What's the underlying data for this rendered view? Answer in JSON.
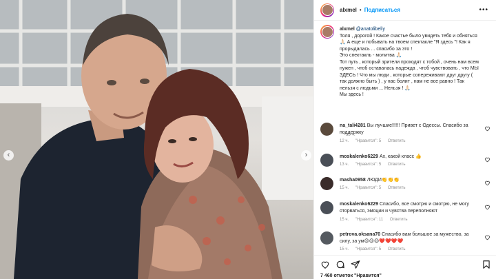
{
  "post": {
    "username": "alxmel",
    "follow_label": "Подписаться",
    "caption_mention": "@anatolibeliy",
    "caption_lines": [
      "Толя , дорогой ! Какое счастье было увидеть тебя и обняться",
      "🙏🏻 А еще и побывать на твоем спектакле \"Я здесь \"! Как я",
      "прорыдалась ... спасибо за это !",
      "Это спектакль - молитва 🙏🏻",
      "Тот путь , который зрители проходят с тобой , очень нам всем",
      "нужен , чтоб оставалась надежда , чтоб чувствовать , что МЫ",
      "ЗДЕСЬ ! Что мы люди , которые сопереживают друг другу (",
      "так должно быть ) , у нас болит , нам не все равно ! Так",
      "нельзя с людьми ... Нельзя ! 🙏🏻",
      "Мы здесь !"
    ],
    "caption_time": "15 ч.",
    "likes": "7 460 отметок \"Нравится\""
  },
  "comments": [
    {
      "username": "na_tali4281",
      "text_lines": [
        "Вы лучшие!!!!!! Привет с Одессы. Спасибо за",
        "поддержку"
      ],
      "time": "12 ч.",
      "likes": "\"Нравится\": 5",
      "reply": "Ответить",
      "avatar_color": "#5a4a3c"
    },
    {
      "username": "moskalenko6229",
      "text_lines": [
        "Ах, какой класс 👍"
      ],
      "time": "13 ч.",
      "likes": "\"Нравится\": 5",
      "reply": "Ответить",
      "avatar_color": "#4a4f57"
    },
    {
      "username": "masha0958",
      "text_lines": [
        "ЛЮДИ👏👏👏"
      ],
      "time": "15 ч.",
      "likes": "\"Нравится\": 5",
      "reply": "Ответить",
      "avatar_color": "#3a2c2a"
    },
    {
      "username": "moskalenko6229",
      "text_lines": [
        "Спасибо, все смотрю и смотрю, не могу",
        "оторваться, эмоции и чувства переполняют"
      ],
      "time": "15 ч.",
      "likes": "\"Нравится\": 11",
      "reply": "Ответить",
      "avatar_color": "#4a4f57"
    },
    {
      "username": "petrova.oksana70",
      "text_lines": [
        "Спасибо вам большое за мужество, за",
        "силу, за ум😍😍😍❤️❤️❤️❤️"
      ],
      "time": "15 ч.",
      "likes": "\"Нравится\": 5",
      "reply": "Ответить",
      "avatar_color": "#555a60"
    }
  ],
  "icons": [
    "more-icon",
    "heart-icon",
    "comment-icon",
    "share-icon",
    "bookmark-icon",
    "chevron-left-icon",
    "chevron-right-icon"
  ]
}
